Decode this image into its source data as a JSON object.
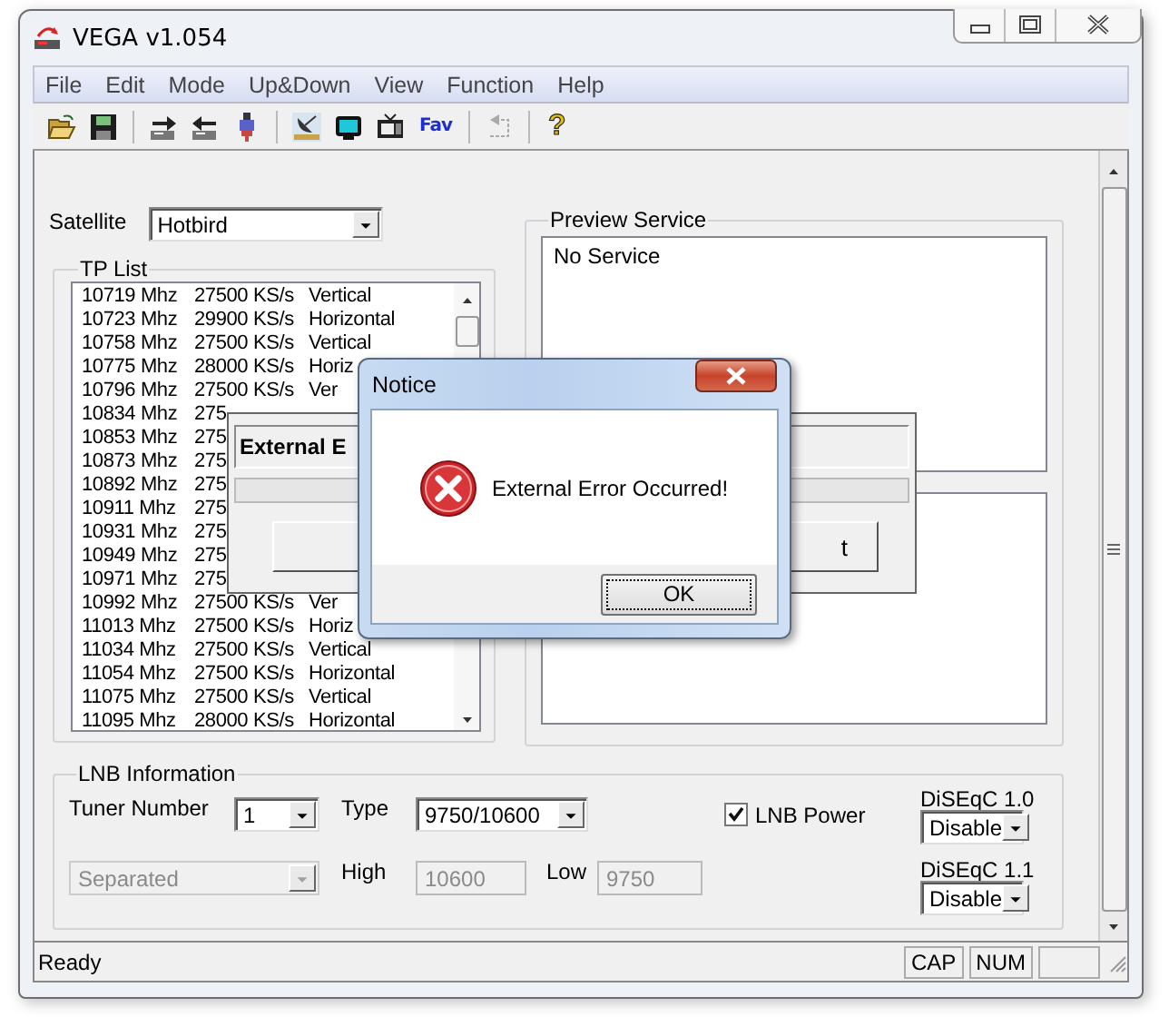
{
  "window": {
    "title": "VEGA v1.054"
  },
  "menu": [
    "File",
    "Edit",
    "Mode",
    "Up&Down",
    "View",
    "Function",
    "Help"
  ],
  "toolbar": {
    "fav_label": "Fav",
    "help_label": "?",
    "undo_disabled": true
  },
  "satellite": {
    "label": "Satellite",
    "value": "Hotbird"
  },
  "tp_list": {
    "title": "TP List",
    "rows": [
      {
        "frequency": "10719 Mhz",
        "symbol_rate": "27500 KS/s",
        "polarization": "Vertical"
      },
      {
        "frequency": "10723 Mhz",
        "symbol_rate": "29900 KS/s",
        "polarization": "Horizontal"
      },
      {
        "frequency": "10758 Mhz",
        "symbol_rate": "27500 KS/s",
        "polarization": "Vertical"
      },
      {
        "frequency": "10775 Mhz",
        "symbol_rate": "28000 KS/s",
        "polarization": "Horiz"
      },
      {
        "frequency": "10796 Mhz",
        "symbol_rate": "27500 KS/s",
        "polarization": "Ver"
      },
      {
        "frequency": "10834 Mhz",
        "symbol_rate": "275"
      },
      {
        "frequency": "10853 Mhz",
        "symbol_rate": "275"
      },
      {
        "frequency": "10873 Mhz",
        "symbol_rate": "275"
      },
      {
        "frequency": "10892 Mhz",
        "symbol_rate": "275"
      },
      {
        "frequency": "10911 Mhz",
        "symbol_rate": "275"
      },
      {
        "frequency": "10931 Mhz",
        "symbol_rate": "275"
      },
      {
        "frequency": "10949 Mhz",
        "symbol_rate": "275"
      },
      {
        "frequency": "10971 Mhz",
        "symbol_rate": "275"
      },
      {
        "frequency": "10992 Mhz",
        "symbol_rate": "27500 KS/s",
        "polarization": "Ver"
      },
      {
        "frequency": "11013 Mhz",
        "symbol_rate": "27500 KS/s",
        "polarization": "Horiz"
      },
      {
        "frequency": "11034 Mhz",
        "symbol_rate": "27500 KS/s",
        "polarization": "Vertical"
      },
      {
        "frequency": "11054 Mhz",
        "symbol_rate": "27500 KS/s",
        "polarization": "Horizontal"
      },
      {
        "frequency": "11075 Mhz",
        "symbol_rate": "27500 KS/s",
        "polarization": "Vertical"
      },
      {
        "frequency": "11095 Mhz",
        "symbol_rate": "28000 KS/s",
        "polarization": "Horizontal"
      }
    ]
  },
  "preview": {
    "title": "Preview Service",
    "text": "No Service"
  },
  "lnb": {
    "title": "LNB Information",
    "tuner": {
      "label": "Tuner Number",
      "value": "1"
    },
    "type": {
      "label": "Type",
      "value": "9750/10600"
    },
    "power": {
      "label": "LNB Power",
      "checked": true
    },
    "mode": {
      "value": "Separated",
      "disabled": true
    },
    "high": {
      "label": "High",
      "value": "10600",
      "disabled": true
    },
    "low": {
      "label": "Low",
      "value": "9750",
      "disabled": true
    },
    "diseqc": [
      {
        "label": "DiSEqC 1.0",
        "value": "Disable"
      },
      {
        "label": "DiSEqC 1.1",
        "value": "Disable"
      }
    ]
  },
  "status_bar": {
    "text": "Ready",
    "indicators": [
      "CAP",
      "NUM"
    ]
  },
  "progress_dialog": {
    "message": "External E",
    "button": "t"
  },
  "notice": {
    "title": "Notice",
    "message": "External Error Occurred!",
    "button": "OK"
  }
}
